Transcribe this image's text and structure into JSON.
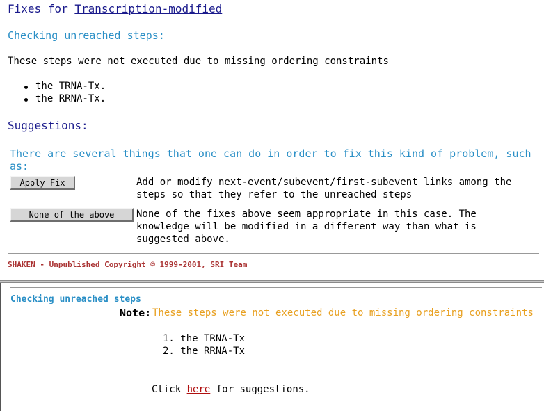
{
  "top": {
    "title_prefix": "Fixes for",
    "title_link": "Transcription-modified",
    "checking_heading": "Checking unreached steps:",
    "intro_text": "These steps were not executed due to missing ordering constraints",
    "unreached_steps": [
      "the TRNA-Tx.",
      "the RRNA-Tx."
    ],
    "suggestions_heading": "Suggestions:",
    "several_text": "There are several things that one can do in order to fix this kind of problem, such as:",
    "fixes": [
      {
        "button": "Apply Fix",
        "description": "Add or modify next-event/subevent/first-subevent links among the steps so that they refer to the unreached steps"
      },
      {
        "button": "None of the above",
        "description": "None of the fixes above seem appropriate in this case. The knowledge will be modified in a different way than what is suggested above."
      }
    ],
    "copyright": "SHAKEN - Unpublished Copyright © 1999-2001, SRI Team"
  },
  "bottom": {
    "checking_heading": "Checking unreached steps",
    "note_label": "Note:",
    "note_text": "These steps were not executed due to missing ordering constraints",
    "steps": [
      "1. the TRNA-Tx",
      "2. the RRNA-Tx"
    ],
    "click_prefix": "Click",
    "click_link": "here",
    "click_suffix": "for suggestions."
  },
  "colors": {
    "heading_blue": "#2a8fc6",
    "title_navy": "#1a1a8c",
    "note_orange": "#e8a020",
    "copyright_red": "#aa3333",
    "link_red": "#b01010"
  }
}
